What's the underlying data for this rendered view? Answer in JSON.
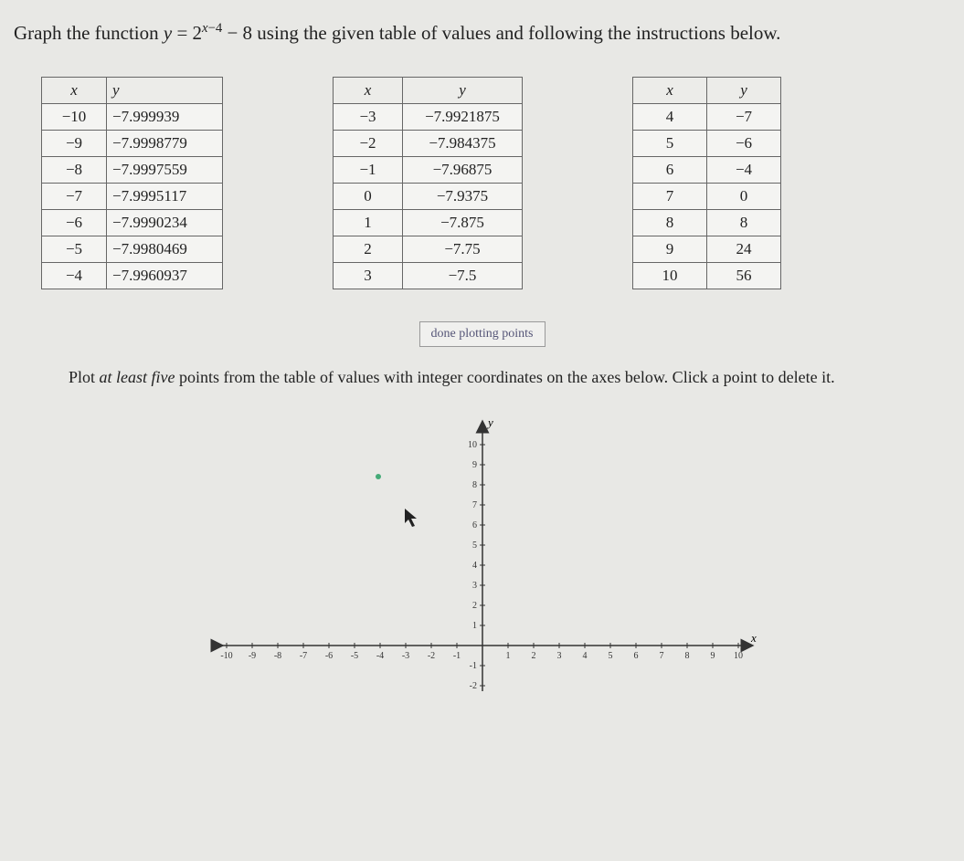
{
  "question_html": "Graph the function <span class='math-var'>y</span> = 2<sup><span class='math-var'>x</span>−4</sup> − 8 using the given table of values and following the instructions below.",
  "tables": {
    "t1": {
      "headers": [
        "x",
        "y"
      ],
      "rows": [
        [
          "−10",
          "−7.999939"
        ],
        [
          "−9",
          "−7.9998779"
        ],
        [
          "−8",
          "−7.9997559"
        ],
        [
          "−7",
          "−7.9995117"
        ],
        [
          "−6",
          "−7.9990234"
        ],
        [
          "−5",
          "−7.9980469"
        ],
        [
          "−4",
          "−7.9960937"
        ]
      ]
    },
    "t2": {
      "headers": [
        "x",
        "y"
      ],
      "rows": [
        [
          "−3",
          "−7.9921875"
        ],
        [
          "−2",
          "−7.984375"
        ],
        [
          "−1",
          "−7.96875"
        ],
        [
          "0",
          "−7.9375"
        ],
        [
          "1",
          "−7.875"
        ],
        [
          "2",
          "−7.75"
        ],
        [
          "3",
          "−7.5"
        ]
      ]
    },
    "t3": {
      "headers": [
        "x",
        "y"
      ],
      "rows": [
        [
          "4",
          "−7"
        ],
        [
          "5",
          "−6"
        ],
        [
          "6",
          "−4"
        ],
        [
          "7",
          "0"
        ],
        [
          "8",
          "8"
        ],
        [
          "9",
          "24"
        ],
        [
          "10",
          "56"
        ]
      ]
    }
  },
  "done_button": "done plotting points",
  "instruction_html": "Plot <em>at least five</em> points from the table of values with integer coordinates on the axes below. Click a point to delete it.",
  "axes": {
    "x_label": "x",
    "y_label": "y",
    "x_ticks": [
      "-10",
      "-9",
      "-8",
      "-7",
      "-6",
      "-5",
      "-4",
      "-3",
      "-2",
      "-1",
      "1",
      "2",
      "3",
      "4",
      "5",
      "6",
      "7",
      "8",
      "9",
      "10"
    ],
    "y_ticks_pos": [
      "1",
      "2",
      "3",
      "4",
      "5",
      "6",
      "7",
      "8",
      "9",
      "10"
    ],
    "y_ticks_neg": [
      "-1",
      "-2"
    ]
  }
}
